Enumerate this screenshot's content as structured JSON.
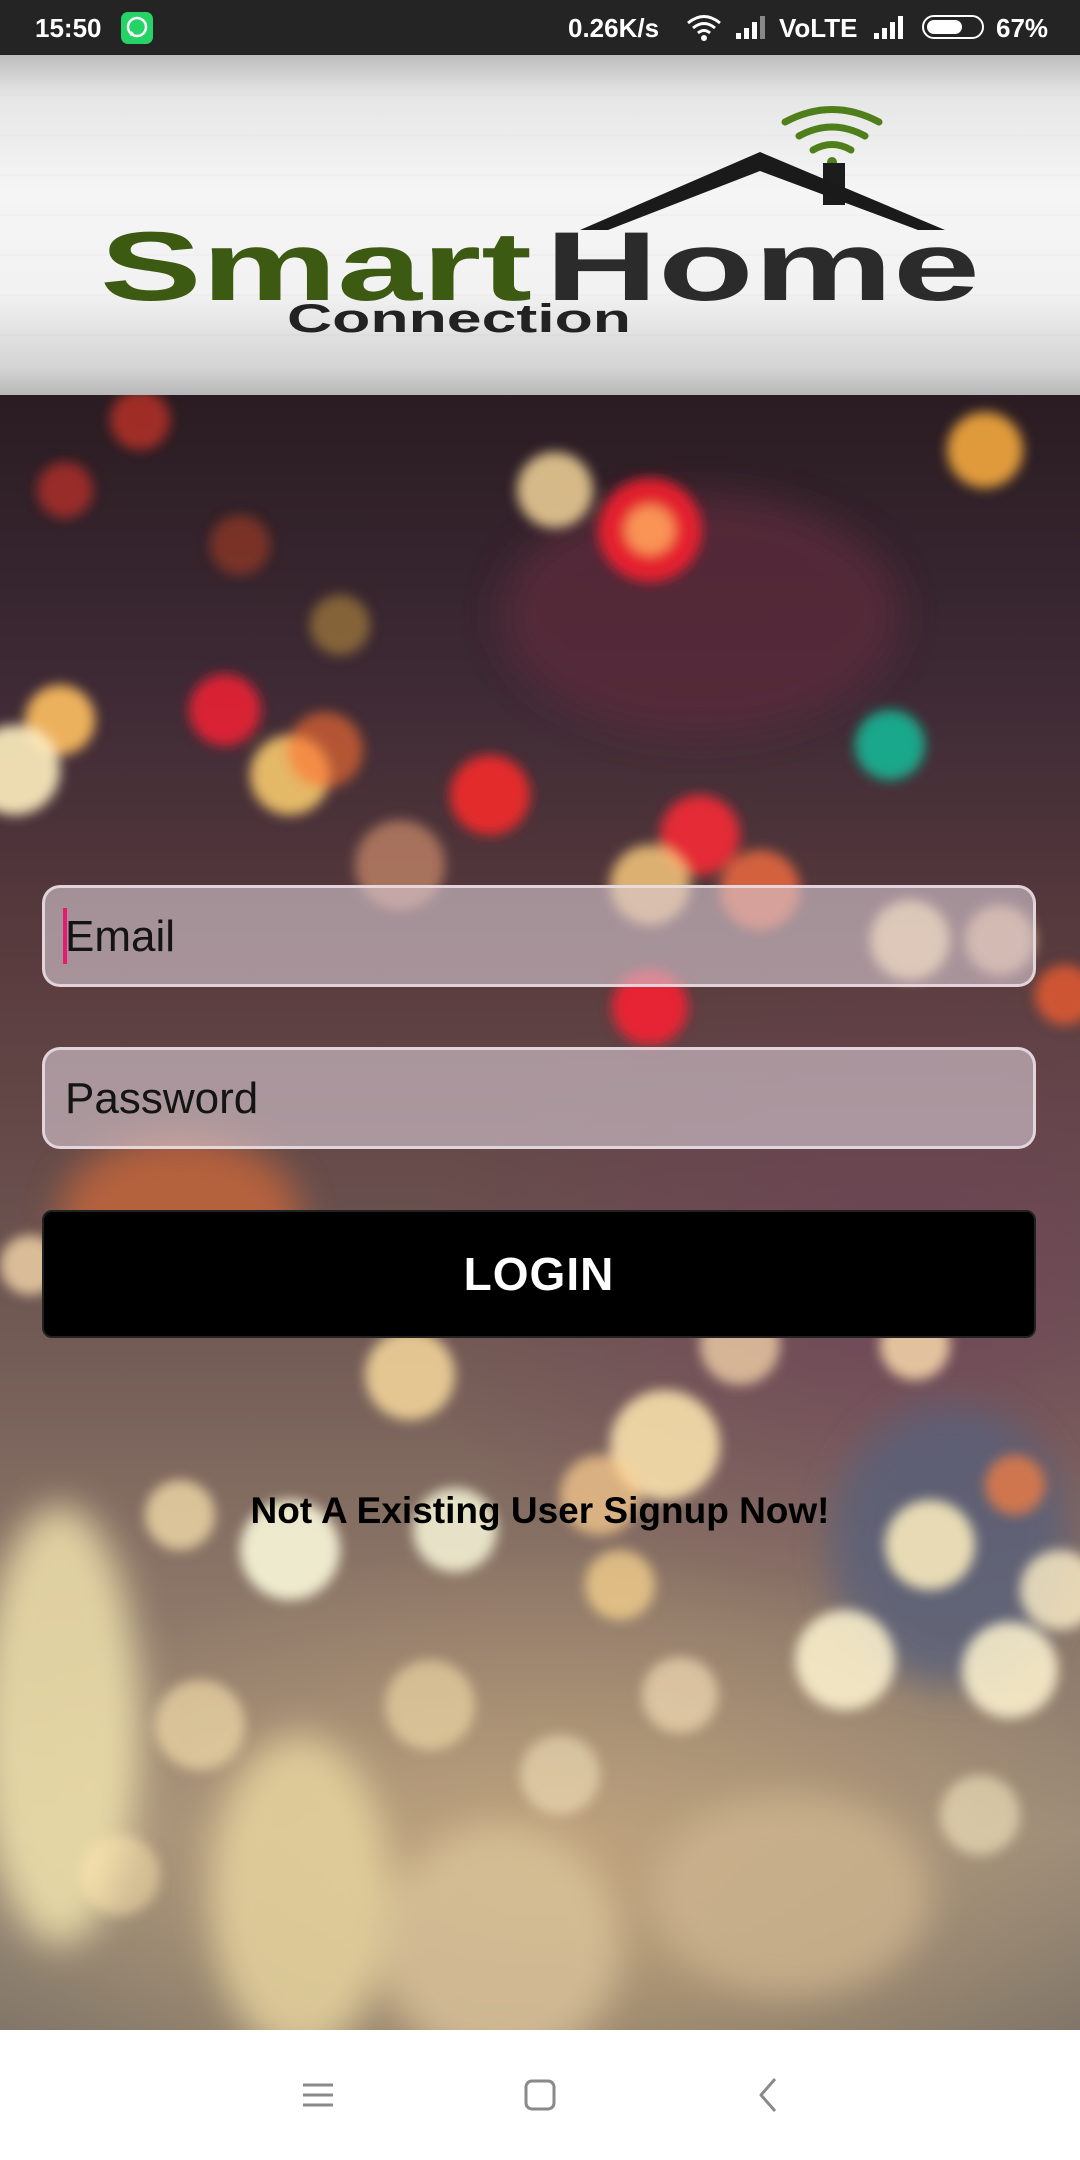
{
  "status_bar": {
    "time": "15:50",
    "network_speed": "0.26K/s",
    "network_type": "VoLTE",
    "battery_percent": "67%",
    "battery_level": 0.67,
    "app_icon": "whatsapp-icon"
  },
  "header": {
    "logo_word_1": "Smart",
    "logo_word_2": "Home",
    "logo_subtitle": "Connection"
  },
  "form": {
    "email_placeholder": "Email",
    "email_value": "",
    "password_placeholder": "Password",
    "password_value": "",
    "login_label": "LOGIN",
    "signup_text": "Not A Existing User Signup Now!"
  },
  "nav": {
    "menu_icon": "menu-icon",
    "home_icon": "home-square-icon",
    "back_icon": "back-chevron-icon"
  },
  "colors": {
    "logo_green": "#3d5a12",
    "cursor": "#e9196e",
    "button_bg": "#000000",
    "status_bar_bg": "#242424"
  }
}
